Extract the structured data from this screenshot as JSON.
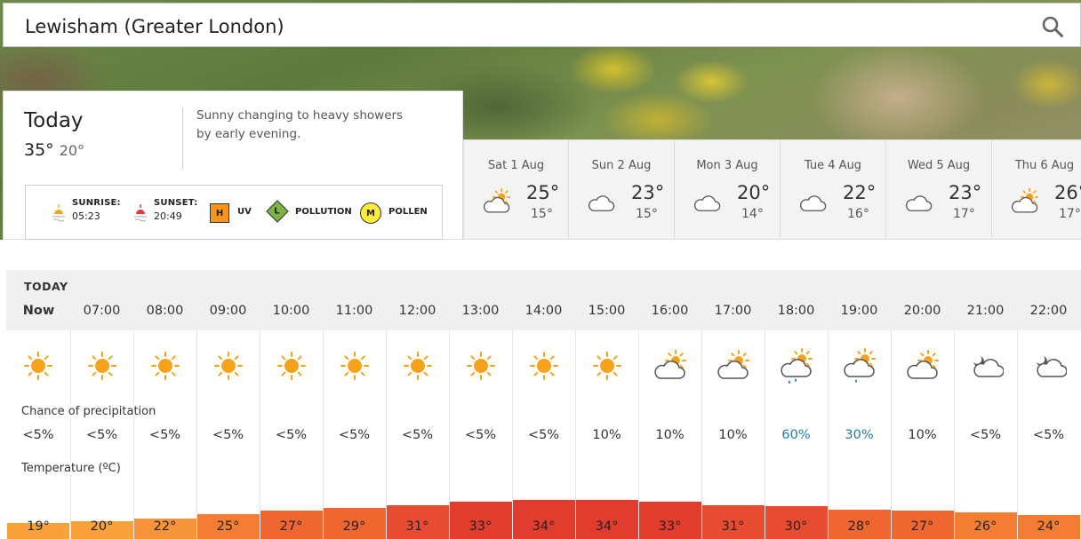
{
  "search": {
    "location": "Lewisham (Greater London)"
  },
  "today": {
    "title": "Today",
    "high": "35°",
    "low": "20°",
    "summary": "Sunny changing to heavy showers by early evening.",
    "sunrise_label": "SUNRISE:",
    "sunrise": "05:23",
    "sunset_label": "SUNSET:",
    "sunset": "20:49",
    "uv_badge": "H",
    "uv_label": "UV",
    "pollution_badge": "L",
    "pollution_label": "POLLUTION",
    "pollen_badge": "M",
    "pollen_label": "POLLEN"
  },
  "days": [
    {
      "name": "Sat 1 Aug",
      "high": "25°",
      "low": "15°",
      "icon": "sunny-intervals-icon"
    },
    {
      "name": "Sun 2 Aug",
      "high": "23°",
      "low": "15°",
      "icon": "cloud-icon"
    },
    {
      "name": "Mon 3 Aug",
      "high": "20°",
      "low": "14°",
      "icon": "cloud-icon"
    },
    {
      "name": "Tue 4 Aug",
      "high": "22°",
      "low": "16°",
      "icon": "cloud-icon"
    },
    {
      "name": "Wed 5 Aug",
      "high": "23°",
      "low": "17°",
      "icon": "cloud-icon"
    },
    {
      "name": "Thu 6 Aug",
      "high": "26°",
      "low": "17°",
      "icon": "sunny-intervals-icon"
    }
  ],
  "hourly": {
    "heading": "TODAY",
    "precip_label": "Chance of precipitation",
    "temp_label": "Temperature (ºC)",
    "hours": [
      {
        "time": "Now",
        "icon": "sun-icon",
        "precip": "<5%",
        "temp": "19°",
        "t": 19
      },
      {
        "time": "07:00",
        "icon": "sun-icon",
        "precip": "<5%",
        "temp": "20°",
        "t": 20
      },
      {
        "time": "08:00",
        "icon": "sun-icon",
        "precip": "<5%",
        "temp": "22°",
        "t": 22
      },
      {
        "time": "09:00",
        "icon": "sun-icon",
        "precip": "<5%",
        "temp": "25°",
        "t": 25
      },
      {
        "time": "10:00",
        "icon": "sun-icon",
        "precip": "<5%",
        "temp": "27°",
        "t": 27
      },
      {
        "time": "11:00",
        "icon": "sun-icon",
        "precip": "<5%",
        "temp": "29°",
        "t": 29
      },
      {
        "time": "12:00",
        "icon": "sun-icon",
        "precip": "<5%",
        "temp": "31°",
        "t": 31
      },
      {
        "time": "13:00",
        "icon": "sun-icon",
        "precip": "<5%",
        "temp": "33°",
        "t": 33
      },
      {
        "time": "14:00",
        "icon": "sun-icon",
        "precip": "<5%",
        "temp": "34°",
        "t": 34
      },
      {
        "time": "15:00",
        "icon": "sun-icon",
        "precip": "10%",
        "temp": "34°",
        "t": 34
      },
      {
        "time": "16:00",
        "icon": "sunny-intervals-icon",
        "precip": "10%",
        "temp": "33°",
        "t": 33
      },
      {
        "time": "17:00",
        "icon": "sunny-intervals-icon",
        "precip": "10%",
        "temp": "31°",
        "t": 31
      },
      {
        "time": "18:00",
        "icon": "heavy-shower-icon",
        "precip": "60%",
        "temp": "30°",
        "t": 30,
        "high": true
      },
      {
        "time": "19:00",
        "icon": "light-shower-icon",
        "precip": "30%",
        "temp": "28°",
        "t": 28,
        "high": true
      },
      {
        "time": "20:00",
        "icon": "sunny-intervals-icon",
        "precip": "10%",
        "temp": "27°",
        "t": 27
      },
      {
        "time": "21:00",
        "icon": "partly-cloudy-night-icon",
        "precip": "<5%",
        "temp": "26°",
        "t": 26
      },
      {
        "time": "22:00",
        "icon": "partly-cloudy-night-icon",
        "precip": "<5%",
        "temp": "24°",
        "t": 24
      }
    ]
  },
  "colors": {
    "sun": "#f7a21b",
    "temp_scale": [
      "#f9a23c",
      "#f7943a",
      "#f47d34",
      "#f06631",
      "#e84c30",
      "#e23c2e"
    ]
  }
}
